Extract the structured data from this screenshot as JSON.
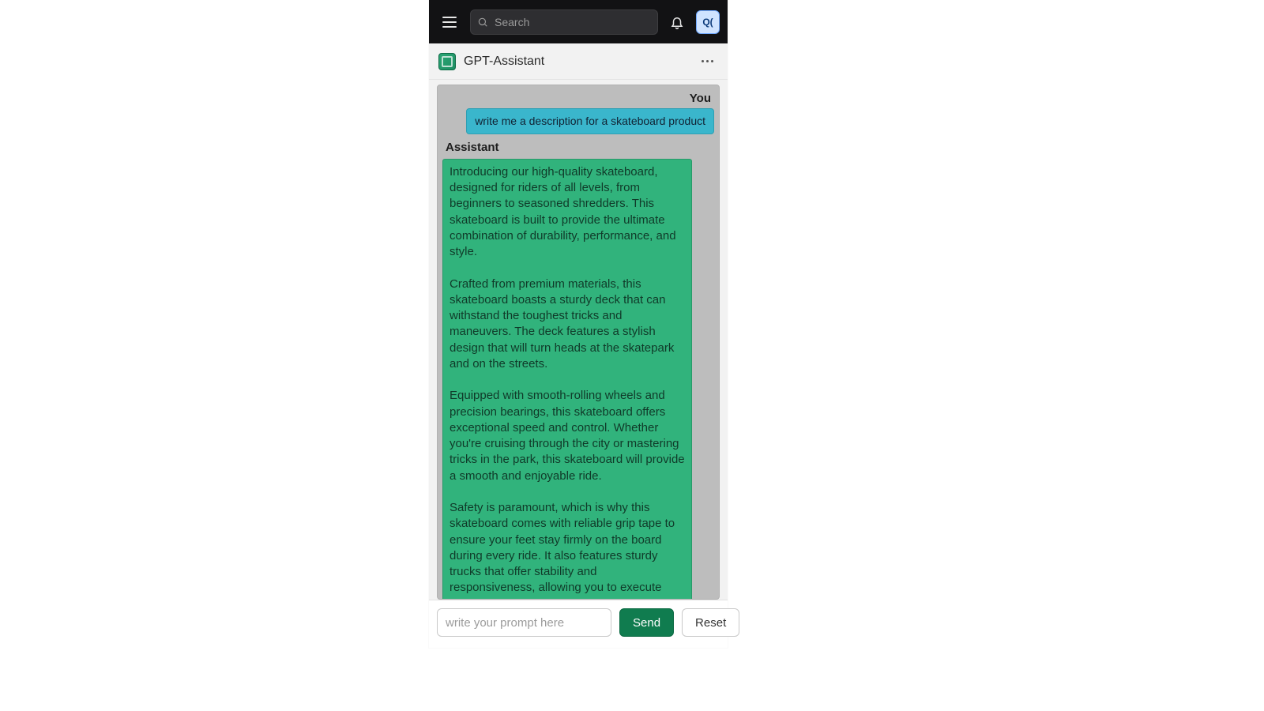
{
  "topbar": {
    "search_placeholder": "Search",
    "avatar_initials": "Q("
  },
  "header": {
    "title": "GPT-Assistant"
  },
  "chat": {
    "you_label": "You",
    "assistant_label": "Assistant",
    "user_message": "write me a description for a skateboard product",
    "assistant_message": "Introducing our high-quality skateboard, designed for riders of all levels, from beginners to seasoned shredders. This skateboard is built to provide the ultimate combination of durability, performance, and style.\n\nCrafted from premium materials, this skateboard boasts a sturdy deck that can withstand the toughest tricks and maneuvers. The deck features a stylish design that will turn heads at the skatepark and on the streets.\n\nEquipped with smooth-rolling wheels and precision bearings, this skateboard offers exceptional speed and control. Whether you're cruising through the city or mastering tricks in the park, this skateboard will provide a smooth and enjoyable ride.\n\nSafety is paramount, which is why this skateboard comes with reliable grip tape to ensure your feet stay firmly on the board during every ride. It also features sturdy trucks that offer stability and responsiveness, allowing you to execute tricks with confidence.\n\nSuitable for riders of all ages and skill levels, this skateboard is perfect for commuting, exercising, or simply having fun with friends. Whether you're"
  },
  "composer": {
    "placeholder": "write your prompt here",
    "send_label": "Send",
    "reset_label": "Reset"
  },
  "colors": {
    "topbar_bg": "#121214",
    "user_bubble": "#3ab6cc",
    "assistant_bubble": "#31b37c",
    "send_button": "#107c4f"
  }
}
